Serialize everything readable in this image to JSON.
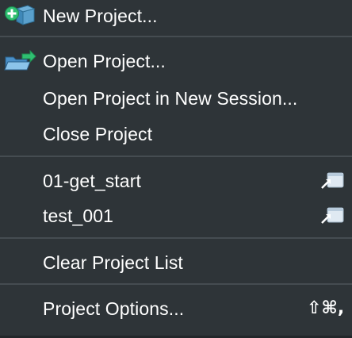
{
  "menu": {
    "items": [
      {
        "label": "New Project...",
        "icon": "new-project-icon"
      },
      {
        "label": "Open Project...",
        "icon": "open-folder-icon"
      },
      {
        "label": "Open Project in New Session..."
      },
      {
        "label": "Close Project"
      },
      {
        "label": "01-get_start",
        "icon": "open-in-new-window-icon"
      },
      {
        "label": "test_001",
        "icon": "open-in-new-window-icon"
      },
      {
        "label": "Clear Project List"
      },
      {
        "label": "Project Options...",
        "shortcut": "⇧⌘,"
      }
    ]
  },
  "colors": {
    "background": "#2e3438",
    "separator": "#454c51",
    "text": "#ffffff",
    "accent_green": "#2fbf71",
    "accent_blue": "#4aa3df"
  }
}
